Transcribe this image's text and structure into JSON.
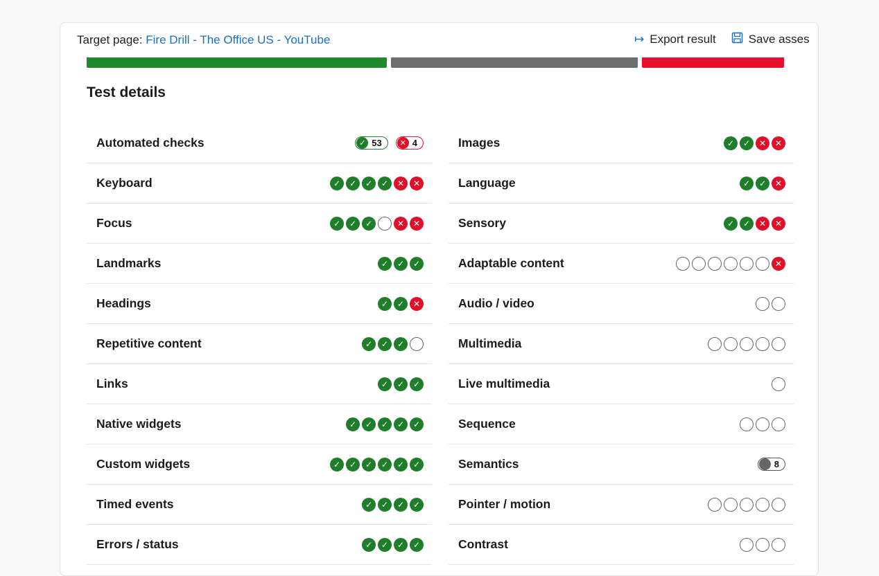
{
  "header": {
    "target_label": "Target page:",
    "target_link": "Fire Drill - The Office US - YouTube",
    "export_label": "Export result",
    "save_label": "Save asses"
  },
  "summary_bar": [
    {
      "status": "pass",
      "color": "#1e8a2c"
    },
    {
      "status": "incomplete",
      "color": "#6e6e6e"
    },
    {
      "status": "fail",
      "color": "#e8112d"
    }
  ],
  "section_title": "Test details",
  "left_column": [
    {
      "name": "Automated checks",
      "pills": [
        {
          "type": "pass",
          "count": "53"
        },
        {
          "type": "fail",
          "count": "4"
        }
      ]
    },
    {
      "name": "Keyboard",
      "statuses": [
        "pass",
        "pass",
        "pass",
        "pass",
        "fail",
        "fail"
      ]
    },
    {
      "name": "Focus",
      "statuses": [
        "pass",
        "pass",
        "pass",
        "empty",
        "fail",
        "fail"
      ]
    },
    {
      "name": "Landmarks",
      "statuses": [
        "pass",
        "pass",
        "pass"
      ]
    },
    {
      "name": "Headings",
      "statuses": [
        "pass",
        "pass",
        "fail"
      ]
    },
    {
      "name": "Repetitive content",
      "statuses": [
        "pass",
        "pass",
        "pass",
        "empty"
      ]
    },
    {
      "name": "Links",
      "statuses": [
        "pass",
        "pass",
        "pass"
      ]
    },
    {
      "name": "Native widgets",
      "statuses": [
        "pass",
        "pass",
        "pass",
        "pass",
        "pass"
      ]
    },
    {
      "name": "Custom widgets",
      "statuses": [
        "pass",
        "pass",
        "pass",
        "pass",
        "pass",
        "pass"
      ]
    },
    {
      "name": "Timed events",
      "statuses": [
        "pass",
        "pass",
        "pass",
        "pass"
      ]
    },
    {
      "name": "Errors / status",
      "statuses": [
        "pass",
        "pass",
        "pass",
        "pass"
      ]
    }
  ],
  "right_column": [
    {
      "name": "Images",
      "statuses": [
        "pass",
        "pass",
        "fail",
        "fail"
      ]
    },
    {
      "name": "Language",
      "statuses": [
        "pass",
        "pass",
        "fail"
      ]
    },
    {
      "name": "Sensory",
      "statuses": [
        "pass",
        "pass",
        "fail",
        "fail"
      ]
    },
    {
      "name": "Adaptable content",
      "statuses": [
        "empty",
        "empty",
        "empty",
        "empty",
        "empty",
        "empty",
        "fail"
      ]
    },
    {
      "name": "Audio / video",
      "statuses": [
        "empty",
        "empty"
      ]
    },
    {
      "name": "Multimedia",
      "statuses": [
        "empty",
        "empty",
        "empty",
        "empty",
        "empty"
      ]
    },
    {
      "name": "Live multimedia",
      "statuses": [
        "empty"
      ]
    },
    {
      "name": "Sequence",
      "statuses": [
        "empty",
        "empty",
        "empty"
      ]
    },
    {
      "name": "Semantics",
      "pills": [
        {
          "type": "neutral",
          "count": "8"
        }
      ]
    },
    {
      "name": "Pointer / motion",
      "statuses": [
        "empty",
        "empty",
        "empty",
        "empty",
        "empty"
      ]
    },
    {
      "name": "Contrast",
      "statuses": [
        "empty",
        "empty",
        "empty"
      ]
    }
  ]
}
